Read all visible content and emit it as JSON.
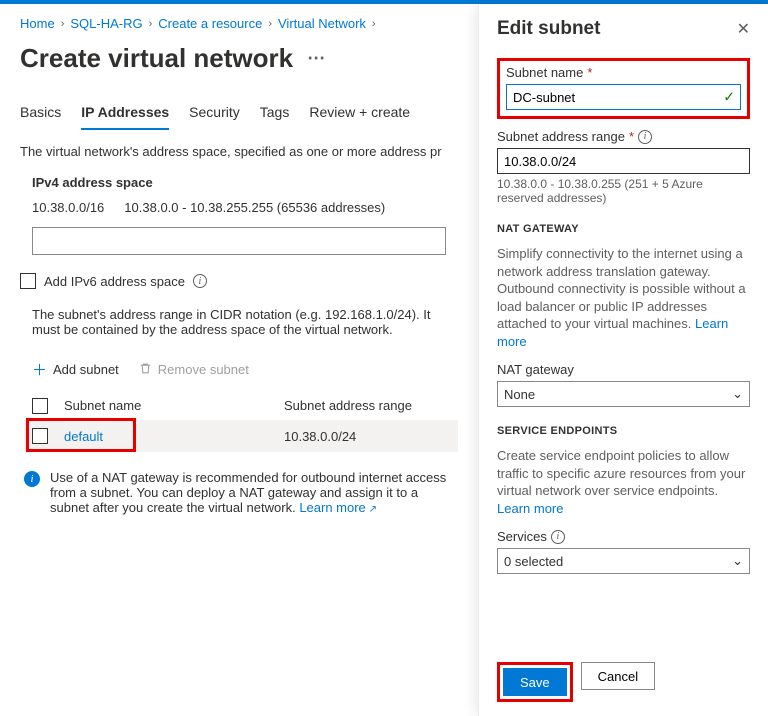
{
  "breadcrumb": [
    "Home",
    "SQL-HA-RG",
    "Create a resource",
    "Virtual Network"
  ],
  "page_title": "Create virtual network",
  "tabs": {
    "basics": "Basics",
    "ip": "IP Addresses",
    "security": "Security",
    "tags": "Tags",
    "review": "Review + create"
  },
  "address_desc": "The virtual network's address space, specified as one or more address pr",
  "ipv4_heading": "IPv4 address space",
  "cidr": "10.38.0.0/16",
  "cidr_range": "10.38.0.0 - 10.38.255.255 (65536 addresses)",
  "ipv6_label": "Add IPv6 address space",
  "subnet_desc": "The subnet's address range in CIDR notation (e.g. 192.168.1.0/24). It must be contained by the address space of the virtual network.",
  "add_subnet": "Add subnet",
  "remove_subnet": "Remove subnet",
  "table": {
    "col_name": "Subnet name",
    "col_range": "Subnet address range",
    "row_name": "default",
    "row_range": "10.38.0.0/24"
  },
  "nat_info": "Use of a NAT gateway is recommended for outbound internet access from a subnet. You can deploy a NAT gateway and assign it to a subnet after you create the virtual network.",
  "learn_more": "Learn more",
  "panel": {
    "title": "Edit subnet",
    "name_label": "Subnet name",
    "name_value": "DC-subnet",
    "range_label": "Subnet address range",
    "range_value": "10.38.0.0/24",
    "range_hint": "10.38.0.0 - 10.38.0.255 (251 + 5 Azure reserved addresses)",
    "nat_head": "NAT GATEWAY",
    "nat_text": "Simplify connectivity to the internet using a network address translation gateway. Outbound connectivity is possible without a load balancer or public IP addresses attached to your virtual machines.",
    "nat_label": "NAT gateway",
    "nat_value": "None",
    "se_head": "SERVICE ENDPOINTS",
    "se_text": "Create service endpoint policies to allow traffic to specific azure resources from your virtual network over service endpoints.",
    "services_label": "Services",
    "services_value": "0 selected",
    "save": "Save",
    "cancel": "Cancel"
  }
}
